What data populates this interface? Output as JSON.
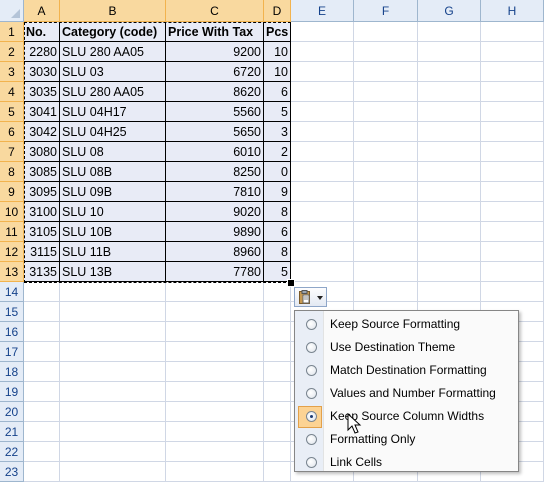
{
  "columns": [
    "A",
    "B",
    "C",
    "D",
    "E",
    "F",
    "G",
    "H"
  ],
  "rows": [
    "1",
    "2",
    "3",
    "4",
    "5",
    "6",
    "7",
    "8",
    "9",
    "10",
    "11",
    "12",
    "13",
    "14",
    "15",
    "16",
    "17",
    "18",
    "19",
    "20",
    "21",
    "22",
    "23"
  ],
  "table": {
    "headers": [
      "No.",
      "Category (code)",
      "Price With Tax",
      "Pcs"
    ],
    "rows": [
      [
        "2280",
        "SLU 280 AA05",
        "9200",
        "10"
      ],
      [
        "3030",
        "SLU 03",
        "6720",
        "10"
      ],
      [
        "3035",
        "SLU 280 AA05",
        "8620",
        "6"
      ],
      [
        "3041",
        "SLU 04H17",
        "5560",
        "5"
      ],
      [
        "3042",
        "SLU 04H25",
        "5650",
        "3"
      ],
      [
        "3080",
        "SLU 08",
        "6010",
        "2"
      ],
      [
        "3085",
        "SLU 08B",
        "8250",
        "0"
      ],
      [
        "3095",
        "SLU 09B",
        "7810",
        "9"
      ],
      [
        "3100",
        "SLU 10",
        "9020",
        "8"
      ],
      [
        "3105",
        "SLU 10B",
        "9890",
        "6"
      ],
      [
        "3115",
        "SLU 11B",
        "8960",
        "8"
      ],
      [
        "3135",
        "SLU 13B",
        "7780",
        "5"
      ]
    ]
  },
  "paste_options": {
    "button_icon": "clipboard-paste-icon",
    "items": [
      {
        "label": "Keep Source Formatting",
        "checked": false
      },
      {
        "label": "Use Destination Theme",
        "checked": false
      },
      {
        "label": "Match Destination Formatting",
        "checked": false
      },
      {
        "label": "Values and Number Formatting",
        "checked": false
      },
      {
        "label": "Keep Source Column Widths",
        "checked": true
      },
      {
        "label": "Formatting Only",
        "checked": false
      },
      {
        "label": "Link Cells",
        "checked": false
      }
    ]
  },
  "colors": {
    "data_fill": "#e8ebf6",
    "header_fill": "#e4ecf7",
    "selected_header_fill": "#f9d99f",
    "checked_item_fill": "#fcd394"
  }
}
